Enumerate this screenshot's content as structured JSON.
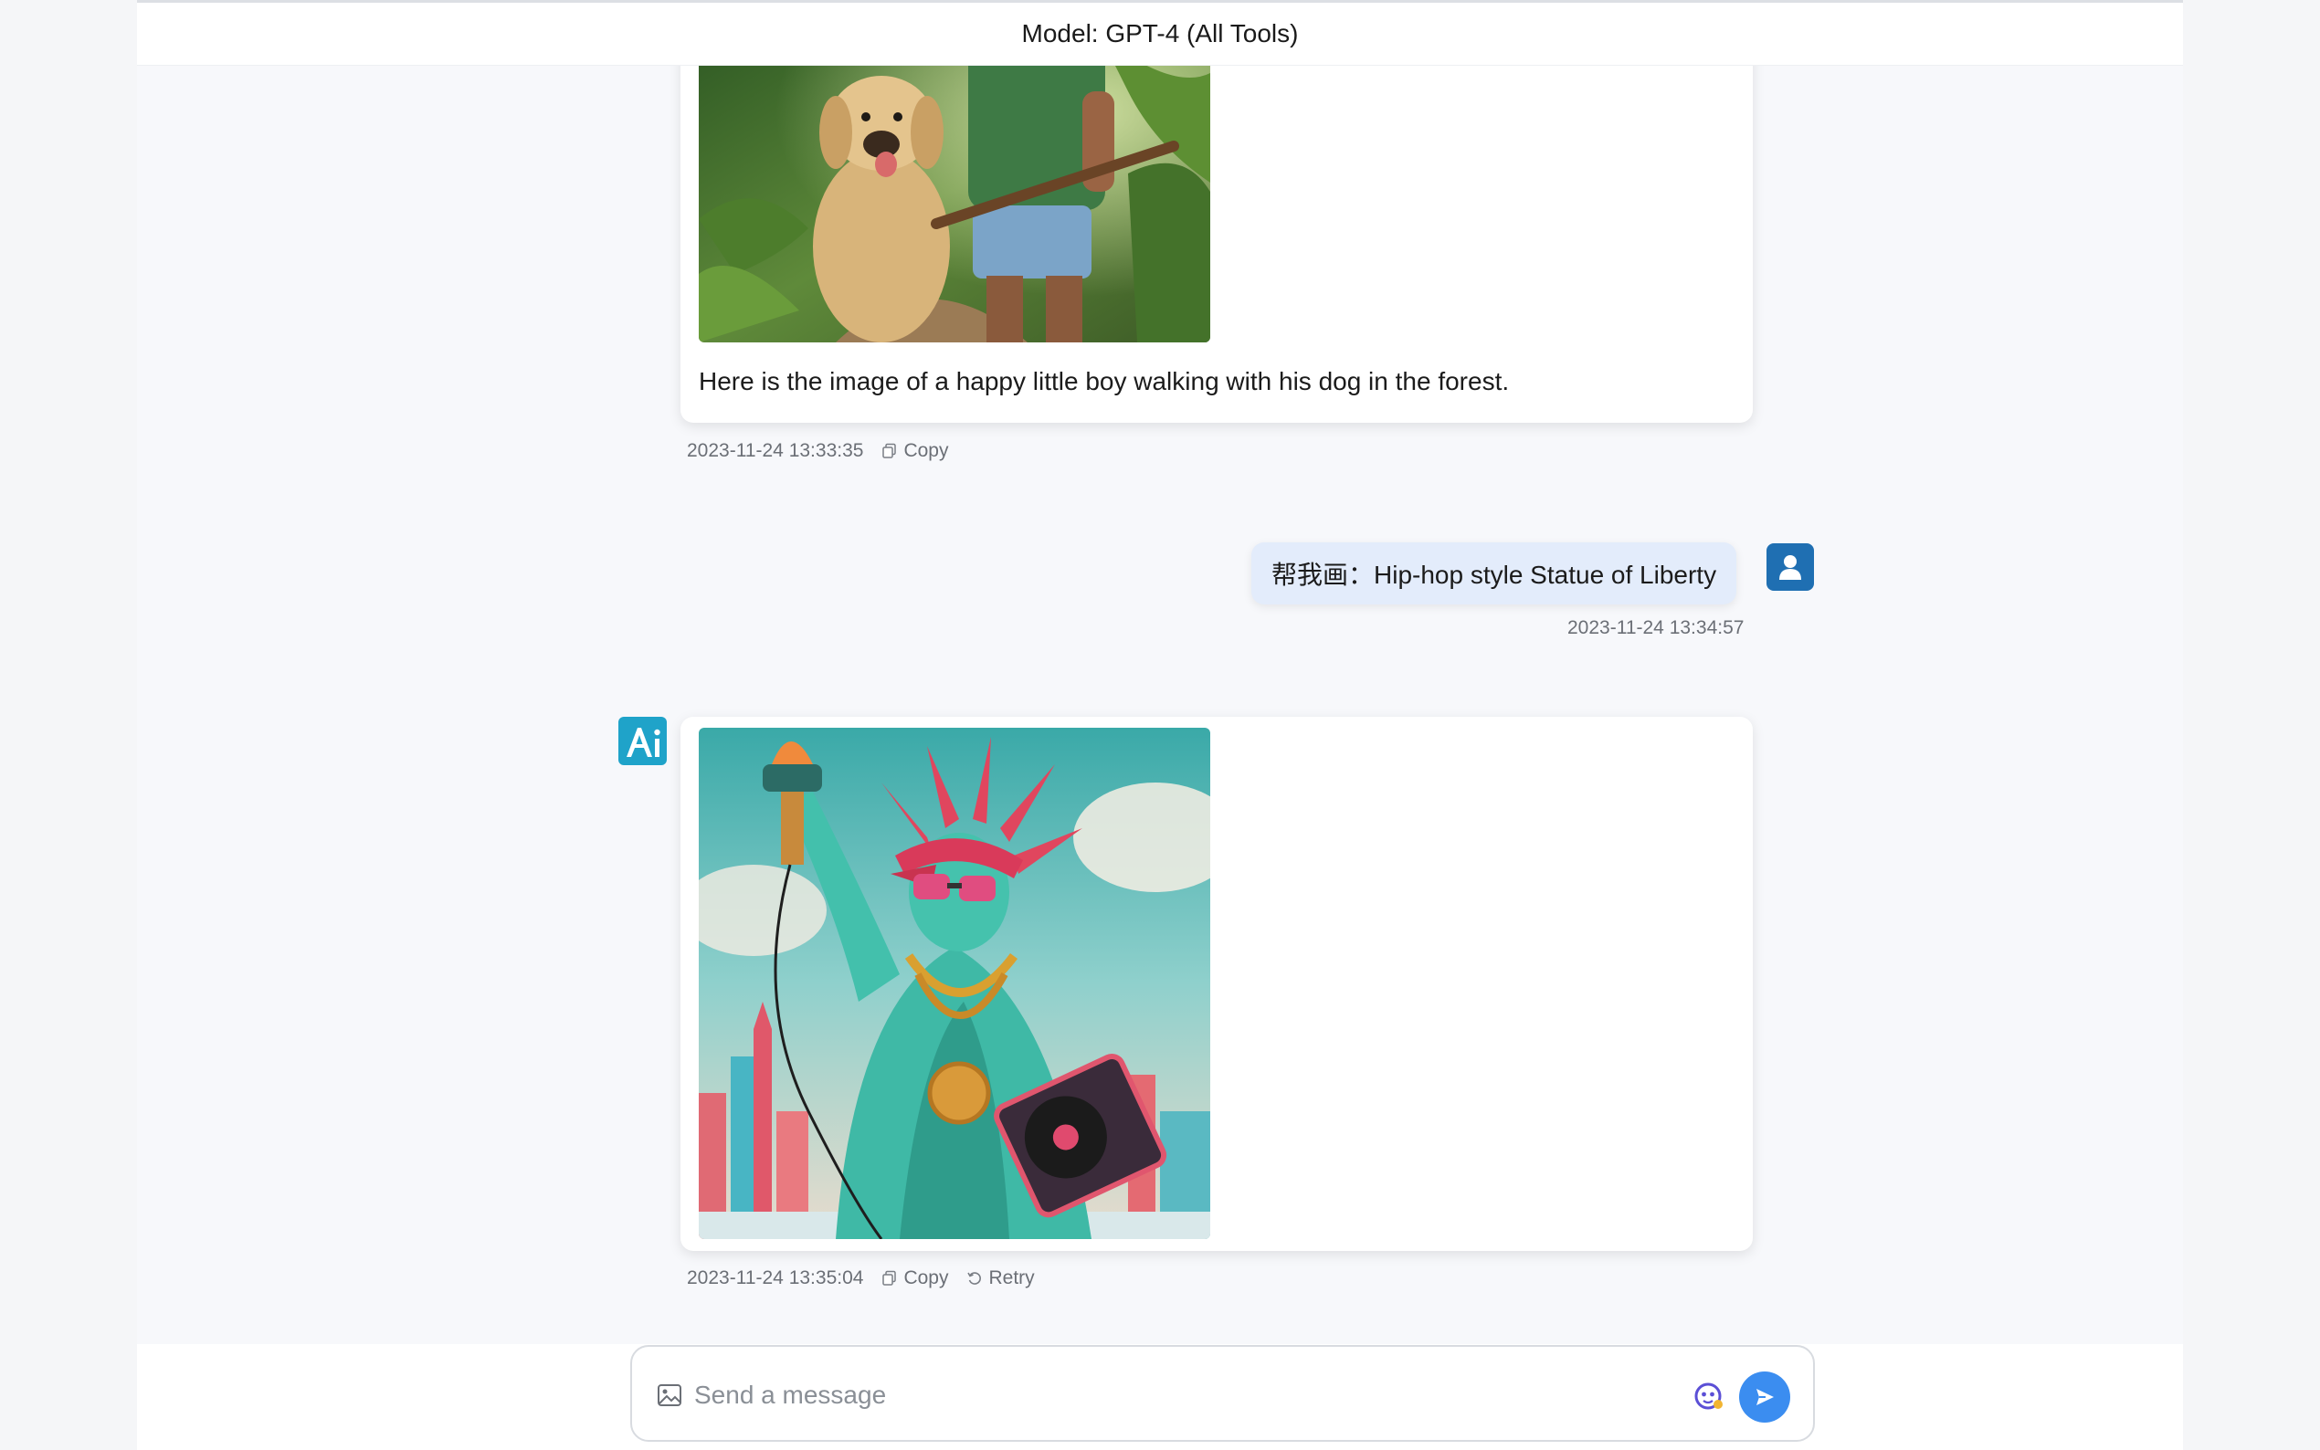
{
  "header": {
    "title": "Model: GPT-4 (All Tools)"
  },
  "messages": [
    {
      "role": "assistant",
      "text": "Here is the image of a happy little boy walking with his dog in the forest.",
      "time": "2023-11-24 13:33:35",
      "actions": {
        "copy": "Copy"
      }
    },
    {
      "role": "user",
      "text": "帮我画：Hip-hop style Statue of Liberty",
      "time": "2023-11-24 13:34:57"
    },
    {
      "role": "assistant",
      "time": "2023-11-24 13:35:04",
      "actions": {
        "copy": "Copy",
        "retry": "Retry"
      }
    }
  ],
  "composer": {
    "placeholder": "Send a message"
  },
  "colors": {
    "accent": "#3b8df0",
    "user_bubble": "#e3ecfb",
    "user_avatar": "#1f6fb2",
    "ai_avatar": "#1fa3c9"
  },
  "icons": [
    "image-upload-icon",
    "emoji-icon",
    "send-icon",
    "copy-icon",
    "retry-icon",
    "user-icon",
    "ai-logo-icon"
  ]
}
